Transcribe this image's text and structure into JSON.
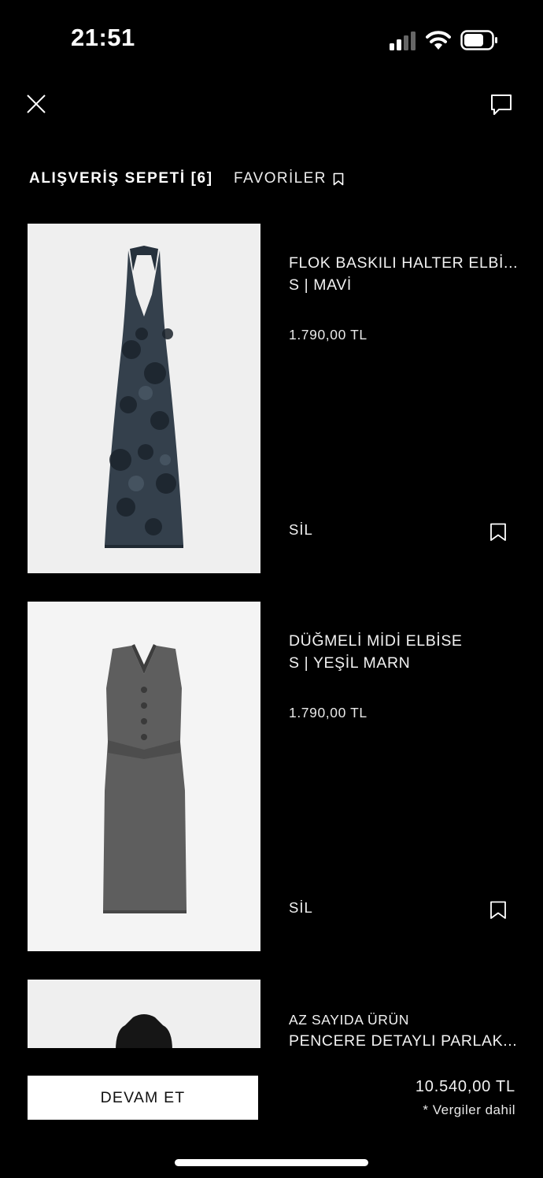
{
  "status_bar": {
    "time": "21:51"
  },
  "header": {
    "close_icon": "close-icon",
    "chat_icon": "chat-icon"
  },
  "tabs": {
    "cart": "ALIŞVERİŞ SEPETİ [6]",
    "favorites": "FAVORİLER"
  },
  "items": [
    {
      "name": "FLOK BASKILI HALTER ELBİ...",
      "variant": "S | MAVİ",
      "price": "1.790,00 TL",
      "remove": "SİL",
      "colors": {
        "bg": "#efefef",
        "dress": "#34404c"
      }
    },
    {
      "name": "DÜĞMELİ MİDİ ELBİSE",
      "variant": "S | YEŞİL MARN",
      "price": "1.790,00 TL",
      "remove": "SİL",
      "colors": {
        "bg": "#f4f4f4",
        "dress": "#5e5e5e"
      }
    },
    {
      "badge": "AZ SAYIDA ÜRÜN",
      "name": "PENCERE DETAYLI PARLAK...",
      "colors": {
        "bg": "#efefef",
        "dress": "#161616"
      }
    }
  ],
  "footer": {
    "continue": "DEVAM ET",
    "total": "10.540,00 TL",
    "tax_note": "* Vergiler dahil"
  }
}
